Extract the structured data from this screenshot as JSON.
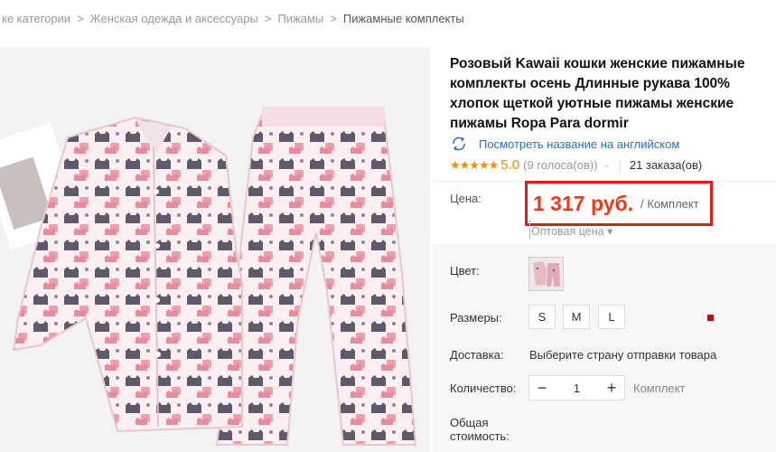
{
  "breadcrumb": {
    "items": [
      "ке категории",
      "Женская одежда и аксессуары",
      "Пижамы"
    ],
    "current": "Пижамные комплекты",
    "separator": ">"
  },
  "product": {
    "title": "Розовый Kawaii кошки женские пижамные комплекты осень Длинные рукава 100% хлопок щеткой уютные пижамы женские пижамы Ropa Para dormir",
    "translate_link": "Посмотреть название на английском",
    "translate_icon": "translate-icon",
    "stars": "★★★★★",
    "rating": "5.0",
    "votes": "(9 голоса(ов))",
    "votes_chevron": "⌄",
    "orders": "21 заказа(ов)",
    "image_icon": "pajama-photo"
  },
  "price": {
    "label": "Цена:",
    "value": "1 317 руб.",
    "unit": "/ Комплект",
    "wholesale": "Оптовая цена ▾",
    "accent_color": "#ee3b14",
    "highlight_color": "#e01d1d"
  },
  "options": {
    "color_label": "Цвет:",
    "sizes_label": "Размеры:",
    "sizes": [
      "S",
      "M",
      "L"
    ],
    "shipping_label": "Доставка:",
    "shipping_text": "Выберите страну отправки товара",
    "quantity_label": "Количество:",
    "quantity_value": "1",
    "quantity_minus": "−",
    "quantity_plus": "+",
    "quantity_unit": "Комплект",
    "total_label_1": "Общая",
    "total_label_2": "стоимость:"
  }
}
